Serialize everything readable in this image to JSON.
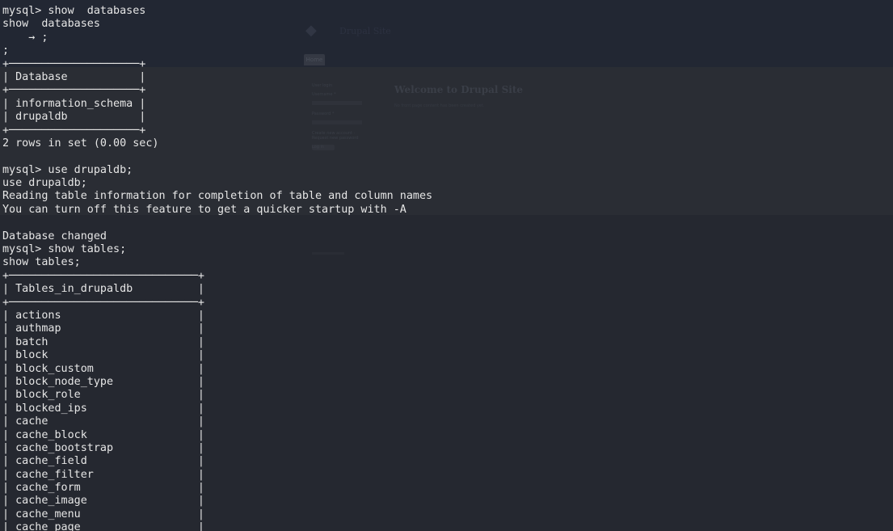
{
  "background_window": {
    "site_name": "Drupal Site",
    "home_tab": "Home",
    "welcome_title": "Welcome to Drupal Site",
    "welcome_text": "No front page content has been created yet.",
    "login_title": "User login",
    "username_label": "Username *",
    "password_label": "Password *",
    "links": "Create new account · Request new password",
    "login_button": "Log in"
  },
  "terminal": {
    "lines": [
      "mysql> show  databases",
      "show  databases",
      "    → ;",
      ";",
      "+────────────────────+",
      "| Database           |",
      "+────────────────────+",
      "| information_schema |",
      "| drupaldb           |",
      "+────────────────────+",
      "2 rows in set (0.00 sec)",
      "",
      "mysql> use drupaldb;",
      "use drupaldb;",
      "Reading table information for completion of table and column names",
      "You can turn off this feature to get a quicker startup with -A",
      "",
      "Database changed",
      "mysql> show tables;",
      "show tables;",
      "+─────────────────────────────+",
      "| Tables_in_drupaldb          |",
      "+─────────────────────────────+",
      "| actions                     |",
      "| authmap                     |",
      "| batch                       |",
      "| block                       |",
      "| block_custom                |",
      "| block_node_type             |",
      "| block_role                  |",
      "| blocked_ips                 |",
      "| cache                       |",
      "| cache_block                 |",
      "| cache_bootstrap             |",
      "| cache_field                 |",
      "| cache_filter                |",
      "| cache_form                  |",
      "| cache_image                 |",
      "| cache_menu                  |",
      "| cache_page                  |"
    ]
  }
}
